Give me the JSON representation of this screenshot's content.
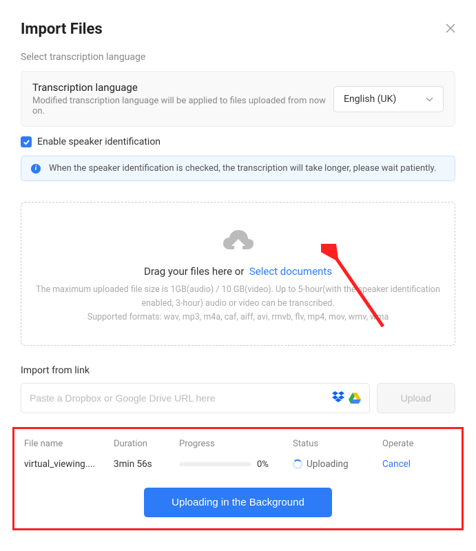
{
  "header": {
    "title": "Import Files"
  },
  "language": {
    "section_label": "Select transcription language",
    "title": "Transcription language",
    "subtitle": "Modified transcription language will be applied to files uploaded from now on.",
    "selected": "English (UK)"
  },
  "speaker_id": {
    "label": "Enable speaker identification",
    "checked": true,
    "info": "When the speaker identification is checked, the transcription will take longer, please wait patiently."
  },
  "dropzone": {
    "drag_text": "Drag your files here or",
    "select_text": "Select documents",
    "line1": "The maximum uploaded file size is 1GB(audio) / 10 GB(video). Up to 5-hour(with the speaker identification enabled, 3-hour) audio or video can be transcribed.",
    "line2": "Supported formats: wav, mp3, m4a, caf, aiff, avi, rmvb, flv, mp4, mov, wmv, wma"
  },
  "import_link": {
    "label": "Import from link",
    "placeholder": "Paste a Dropbox or Google Drive URL here",
    "upload_label": "Upload"
  },
  "uploads": {
    "headers": {
      "filename": "File name",
      "duration": "Duration",
      "progress": "Progress",
      "status": "Status",
      "operate": "Operate"
    },
    "rows": [
      {
        "filename": "virtual_viewing....",
        "duration": "3min 56s",
        "progress_pct": "0%",
        "status": "Uploading",
        "operate": "Cancel"
      }
    ],
    "bg_button": "Uploading in the Background"
  }
}
